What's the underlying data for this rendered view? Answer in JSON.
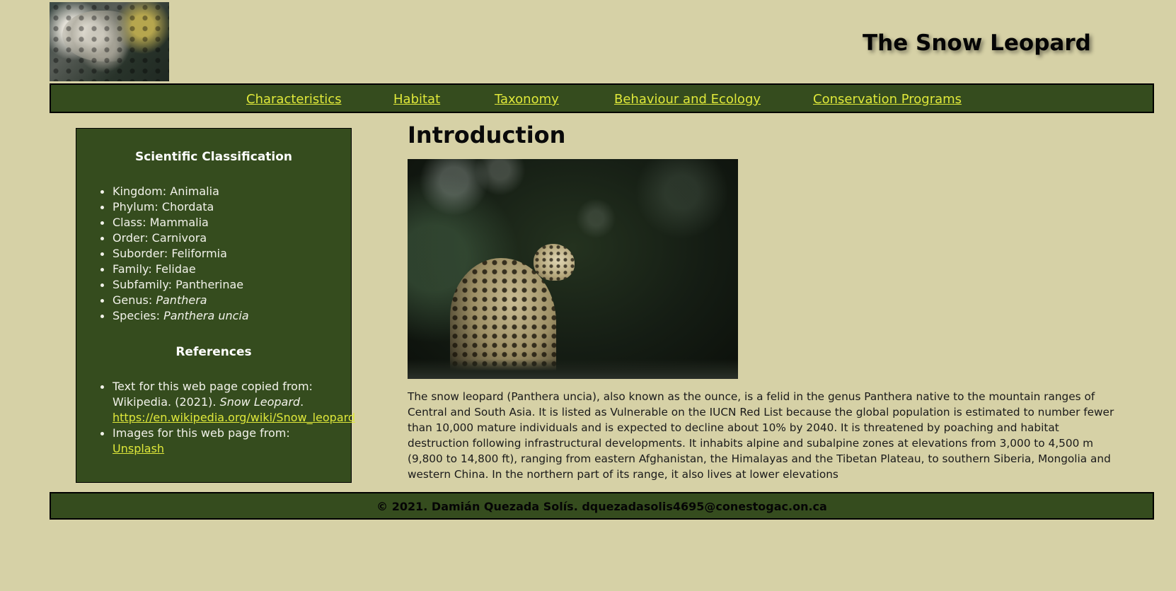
{
  "header": {
    "logo_icon": "snow-leopard-photo",
    "title": "The Snow Leopard"
  },
  "nav": {
    "items": [
      {
        "label": "Characteristics"
      },
      {
        "label": "Habitat"
      },
      {
        "label": "Taxonomy"
      },
      {
        "label": "Behaviour and Ecology"
      },
      {
        "label": "Conservation Programs"
      }
    ]
  },
  "sidebar": {
    "classification_heading": "Scientific Classification",
    "classification": [
      {
        "label": "Kingdom: ",
        "value": "Animalia"
      },
      {
        "label": "Phylum: ",
        "value": "Chordata"
      },
      {
        "label": "Class: ",
        "value": "Mammalia"
      },
      {
        "label": "Order: ",
        "value": "Carnivora"
      },
      {
        "label": "Suborder: ",
        "value": "Feliformia"
      },
      {
        "label": "Family: ",
        "value": "Felidae"
      },
      {
        "label": "Subfamily: ",
        "value": "Pantherinae"
      },
      {
        "label": "Genus: ",
        "value": "Panthera"
      },
      {
        "label": "Species: ",
        "value": "Panthera uncia"
      }
    ],
    "references_heading": "References",
    "references": {
      "ref1_text": "Text for this web page copied from: Wikipedia. (2021). ",
      "ref1_title": "Snow Leopard",
      "ref1_period": ".",
      "ref1_link": "https://en.wikipedia.org/wiki/Snow_leopard",
      "ref2_text": "Images for this web page from: ",
      "ref2_link": "Unsplash"
    }
  },
  "main": {
    "heading": "Introduction",
    "hero_image": "snow-leopard-photo",
    "paragraph": "The snow leopard (Panthera uncia), also known as the ounce, is a felid in the genus Panthera native to the mountain ranges of Central and South Asia. It is listed as Vulnerable on the IUCN Red List because the global population is estimated to number fewer than 10,000 mature individuals and is expected to decline about 10% by 2040. It is threatened by poaching and habitat destruction following infrastructural developments. It inhabits alpine and subalpine zones at elevations from 3,000 to 4,500 m (9,800 to 14,800 ft), ranging from eastern Afghanistan, the Himalayas and the Tibetan Plateau, to southern Siberia, Mongolia and western China. In the northern part of its range, it also lives at lower elevations"
  },
  "footer": {
    "text": "© 2021. Damián Quezada Solís. dquezadasolis4695@conestogac.on.ca"
  },
  "colors": {
    "page_background": "#d6d1a6",
    "panel_green": "#354c1e",
    "link_yellow": "#dfe83a"
  }
}
